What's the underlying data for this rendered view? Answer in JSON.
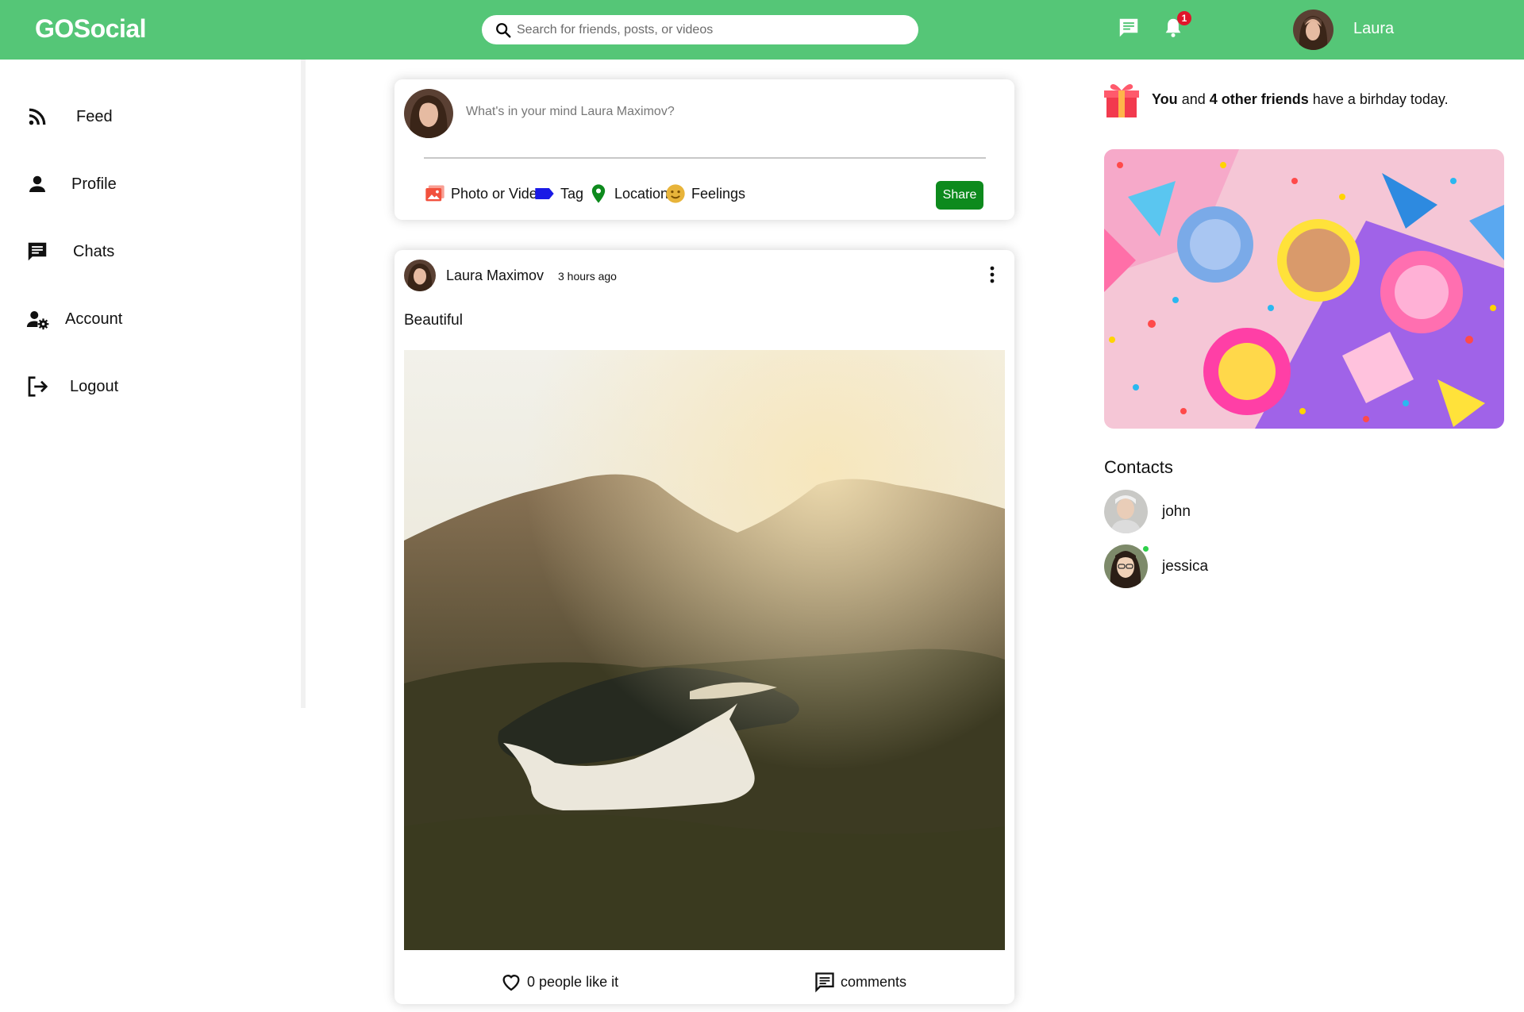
{
  "app": {
    "logo": "GOSocial"
  },
  "search": {
    "placeholder": "Search for friends, posts, or videos"
  },
  "topbar": {
    "notifications_count": "1",
    "username": "Laura",
    "icons": [
      "chat-icon",
      "bell-icon"
    ]
  },
  "sidebar": {
    "items": [
      {
        "label": "Feed",
        "icon": "rss-icon"
      },
      {
        "label": "Profile",
        "icon": "person-icon"
      },
      {
        "label": "Chats",
        "icon": "chat-icon"
      },
      {
        "label": "Account",
        "icon": "user-settings-icon"
      },
      {
        "label": "Logout",
        "icon": "logout-icon"
      }
    ]
  },
  "composer": {
    "placeholder": "What's in your mind Laura Maximov?",
    "options": [
      {
        "label": "Photo or Video",
        "icon": "photo-icon",
        "color": "#f2503c"
      },
      {
        "label": "Tag",
        "icon": "tag-icon",
        "color": "#1a1ae6"
      },
      {
        "label": "Location",
        "icon": "location-icon",
        "color": "#0d8a1d"
      },
      {
        "label": "Feelings",
        "icon": "emoji-icon",
        "color": "#e8b43a"
      }
    ],
    "share_label": "Share"
  },
  "post": {
    "author": "Laura Maximov",
    "time": "3 hours ago",
    "text": "Beautiful",
    "likes_label": "0 people like it",
    "comments_label": "comments"
  },
  "birthday": {
    "you": "You",
    "and": "and",
    "friends": "4 other friends",
    "rest": "have a birhday today."
  },
  "contacts": {
    "title": "Contacts",
    "items": [
      {
        "name": "john",
        "online": false
      },
      {
        "name": "jessica",
        "online": true
      }
    ]
  },
  "colors": {
    "topbar": "#55c677",
    "share": "#0d8a1d",
    "badge": "#e0152b",
    "online": "#2ed04b"
  }
}
